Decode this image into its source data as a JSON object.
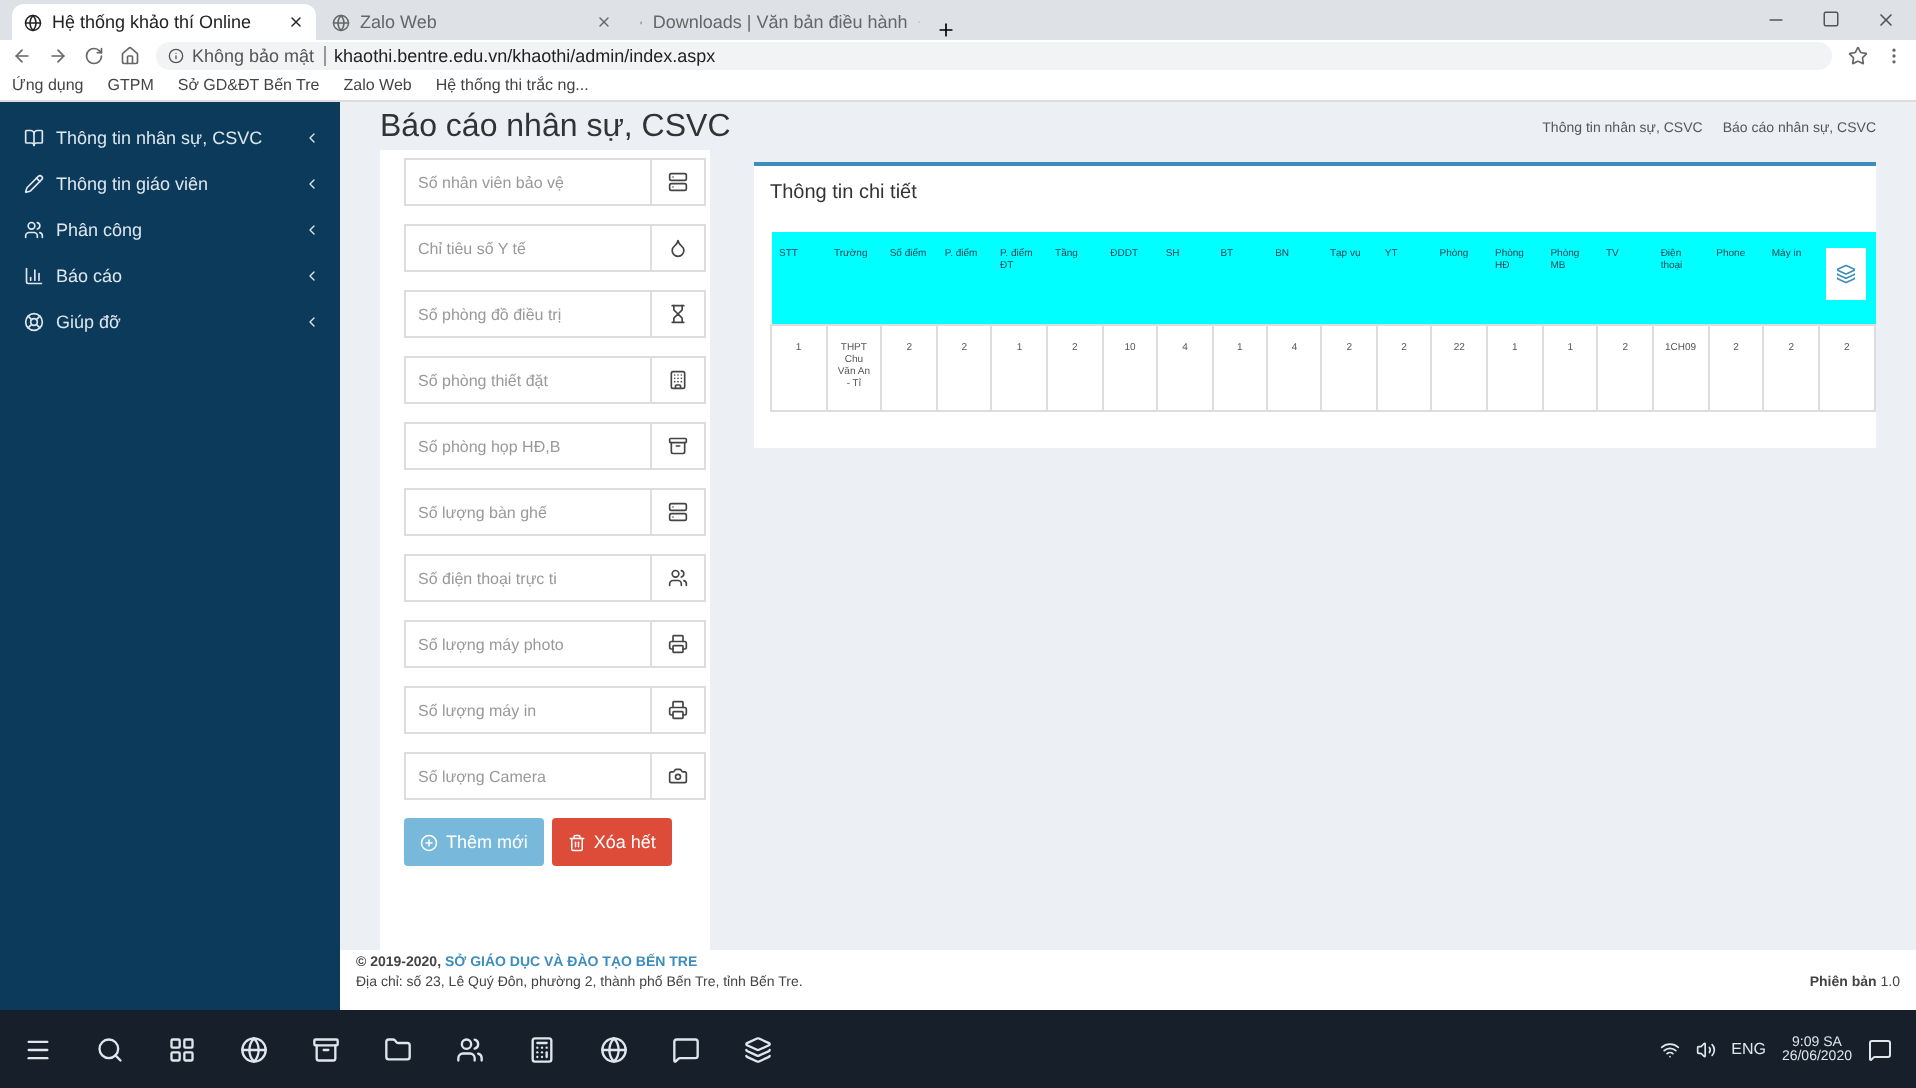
{
  "browser": {
    "tabs": [
      {
        "title": "Hệ thống khảo thí Online",
        "selected": true
      },
      {
        "title": "Zalo Web",
        "selected": false
      },
      {
        "title": "Downloads | Văn bản điều hành",
        "selected": false
      }
    ],
    "address": {
      "security": "Không bảo mật",
      "url": "khaothi.bentre.edu.vn/khaothi/admin/index.aspx"
    },
    "bookmarks": [
      "Ứng dụng",
      "GTPM",
      "Sở GD&ĐT Bến Tre",
      "Zalo Web",
      "Hệ thống thi trắc ng..."
    ]
  },
  "sidebar": {
    "items": [
      {
        "label": "Thông tin nhân sự, CSVC"
      },
      {
        "label": "Thông tin giáo viên"
      },
      {
        "label": "Phân công"
      },
      {
        "label": "Báo cáo"
      },
      {
        "label": "Giúp đỡ"
      }
    ]
  },
  "page": {
    "title": "Báo cáo nhân sự, CSVC",
    "breadcrumb": [
      "Thông tin nhân sự, CSVC",
      "Báo cáo nhân sự, CSVC"
    ]
  },
  "form": {
    "fields": [
      {
        "placeholder": "Số nhân viên bảo vệ"
      },
      {
        "placeholder": "Chỉ tiêu số Y tế"
      },
      {
        "placeholder": "Số phòng đồ điều trị"
      },
      {
        "placeholder": "Số phòng thiết đặt"
      },
      {
        "placeholder": "Số phòng họp HĐ,B"
      },
      {
        "placeholder": "Số lượng bàn ghế"
      },
      {
        "placeholder": "Số điện thoại trực ti"
      },
      {
        "placeholder": "Số lượng máy photo"
      },
      {
        "placeholder": "Số lượng máy in"
      },
      {
        "placeholder": "Số lượng Camera"
      }
    ],
    "buttons": [
      {
        "label": "Thêm mới",
        "kind": "add"
      },
      {
        "label": "Xóa hết",
        "kind": "delete"
      }
    ]
  },
  "details": {
    "title": "Thông tin chi tiết",
    "table": {
      "columns": [
        "STT",
        "Trường",
        "Số điểm",
        "P. điểm",
        "P. điểm ĐT",
        "Tầng",
        "ĐDDT",
        "SH",
        "BT",
        "BN",
        "Tạp vụ",
        "YT",
        "Phòng",
        "Phòng HĐ",
        "Phòng MB",
        "TV",
        "Điện thoại",
        "Phone",
        "Máy in"
      ],
      "rows": [
        [
          "1",
          "THPT Chu Văn An - Tỉ",
          "2",
          "2",
          "1",
          "2",
          "10",
          "4",
          "1",
          "4",
          "2",
          "2",
          "22",
          "1",
          "1",
          "2",
          "1CH09",
          "2",
          "2",
          "2"
        ]
      ]
    }
  },
  "footer": {
    "copyright": "© 2019-2020,",
    "org": "SỞ GIÁO DỤC VÀ ĐÀO TẠO BẾN TRE",
    "address": "Địa chỉ: số 23, Lê Quý Đôn, phường 2, thành phố Bến Tre, tỉnh Bến Tre.",
    "version_label": "Phiên bản",
    "version": "1.0"
  },
  "taskbar": {
    "language": "ENG",
    "time": "9:09 SA",
    "date": "26/06/2020"
  }
}
